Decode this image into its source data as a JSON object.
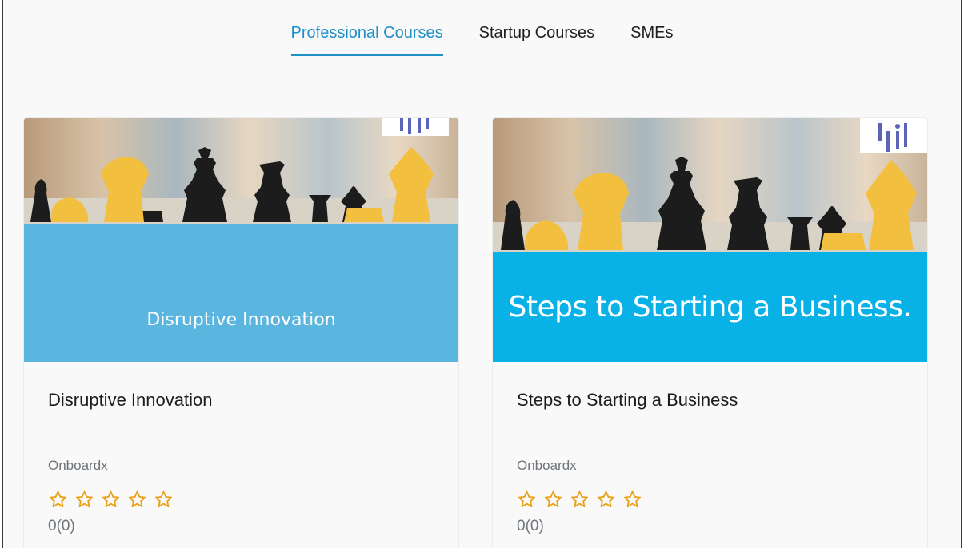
{
  "tabs": [
    {
      "label": "Professional Courses",
      "active": true
    },
    {
      "label": "Startup Courses",
      "active": false
    },
    {
      "label": "SMEs",
      "active": false
    }
  ],
  "courses": [
    {
      "banner_text": "Disruptive Innovation",
      "title": "Disruptive Innovation",
      "org": "Onboardx",
      "rating": 0,
      "rating_text": "0(0)",
      "banner_color": "#5bb6df"
    },
    {
      "banner_text": "Steps to Starting a Business.",
      "title": "Steps to Starting a Business",
      "org": "Onboardx",
      "rating": 0,
      "rating_text": "0(0)",
      "banner_color": "#08b2e6"
    }
  ],
  "colors": {
    "accent": "#1e8fc9",
    "star": "#e8a21c",
    "logo": "#5a63b8"
  },
  "icons": [
    "star-outline-icon",
    "brand-logo-icon",
    "chess-pieces-image"
  ]
}
